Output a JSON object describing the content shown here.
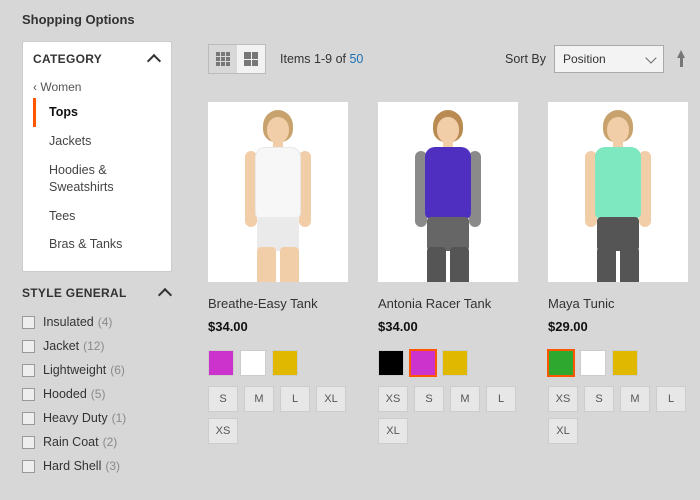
{
  "sidebar": {
    "title": "Shopping Options",
    "category": {
      "label": "CATEGORY",
      "back": "Women",
      "items": [
        {
          "label": "Tops",
          "selected": true
        },
        {
          "label": "Jackets"
        },
        {
          "label": "Hoodies & Sweatshirts"
        },
        {
          "label": "Tees"
        },
        {
          "label": "Bras & Tanks"
        }
      ]
    },
    "style": {
      "label": "STYLE GENERAL",
      "facets": [
        {
          "label": "Insulated",
          "count": 4
        },
        {
          "label": "Jacket",
          "count": 12
        },
        {
          "label": "Lightweight",
          "count": 6
        },
        {
          "label": "Hooded",
          "count": 5
        },
        {
          "label": "Heavy Duty",
          "count": 1
        },
        {
          "label": "Rain Coat",
          "count": 2
        },
        {
          "label": "Hard Shell",
          "count": 3
        }
      ]
    }
  },
  "toolbar": {
    "items_text": "Items 1-9 of ",
    "items_total": "50",
    "sort_label": "Sort By",
    "sort_value": "Position"
  },
  "products": [
    {
      "name": "Breathe-Easy Tank",
      "price": "$34.00",
      "colors": [
        {
          "hex": "#cc33cc",
          "selected": false
        },
        {
          "hex": "#ffffff",
          "selected": false
        },
        {
          "hex": "#e0b800",
          "selected": false
        }
      ],
      "sizes": [
        "S",
        "M",
        "L",
        "XL",
        "XS"
      ]
    },
    {
      "name": "Antonia Racer Tank",
      "price": "$34.00",
      "colors": [
        {
          "hex": "#000000",
          "selected": false
        },
        {
          "hex": "#cc33cc",
          "selected": true
        },
        {
          "hex": "#e0b800",
          "selected": false
        }
      ],
      "sizes": [
        "XS",
        "S",
        "M",
        "L",
        "XL"
      ]
    },
    {
      "name": "Maya Tunic",
      "price": "$29.00",
      "colors": [
        {
          "hex": "#2fa82f",
          "selected": true
        },
        {
          "hex": "#ffffff",
          "selected": false
        },
        {
          "hex": "#e0b800",
          "selected": false
        }
      ],
      "sizes": [
        "XS",
        "S",
        "M",
        "L",
        "XL"
      ]
    }
  ]
}
